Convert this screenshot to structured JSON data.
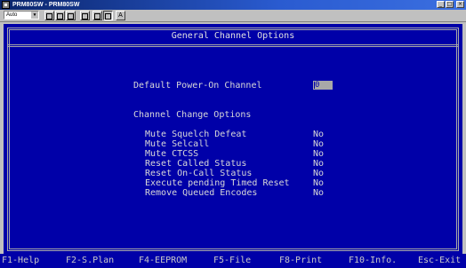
{
  "window": {
    "title": "PRM80SW - PRM80SW",
    "controls": {
      "minimize": "_",
      "maximize": "□",
      "close": "×"
    }
  },
  "toolbar": {
    "font_size": "Auto",
    "font_button_label": "A"
  },
  "screen": {
    "header": "General Channel Options",
    "default_channel_label": "Default Power-On Channel",
    "default_channel_value": "0",
    "section_title": "Channel Change Options",
    "options": [
      {
        "label": "Mute Squelch Defeat",
        "value": "No"
      },
      {
        "label": "Mute Selcall",
        "value": "No"
      },
      {
        "label": "Mute CTCSS",
        "value": "No"
      },
      {
        "label": "Reset Called Status",
        "value": "No"
      },
      {
        "label": "Reset On-Call Status",
        "value": "No"
      },
      {
        "label": "Execute pending Timed Reset",
        "value": "No"
      },
      {
        "label": "Remove Queued Encodes",
        "value": "No"
      }
    ]
  },
  "function_keys": [
    {
      "label": "F1-Help"
    },
    {
      "label": "F2-S.Plan"
    },
    {
      "label": "F4-EEPROM"
    },
    {
      "label": "F5-File"
    },
    {
      "label": "F8-Print"
    },
    {
      "label": "F10-Info."
    },
    {
      "label": "Esc-Exit"
    }
  ],
  "colors": {
    "screen_bg": "#0000a8",
    "text": "#d8d8d8",
    "field_bg": "#a8a8a8"
  }
}
